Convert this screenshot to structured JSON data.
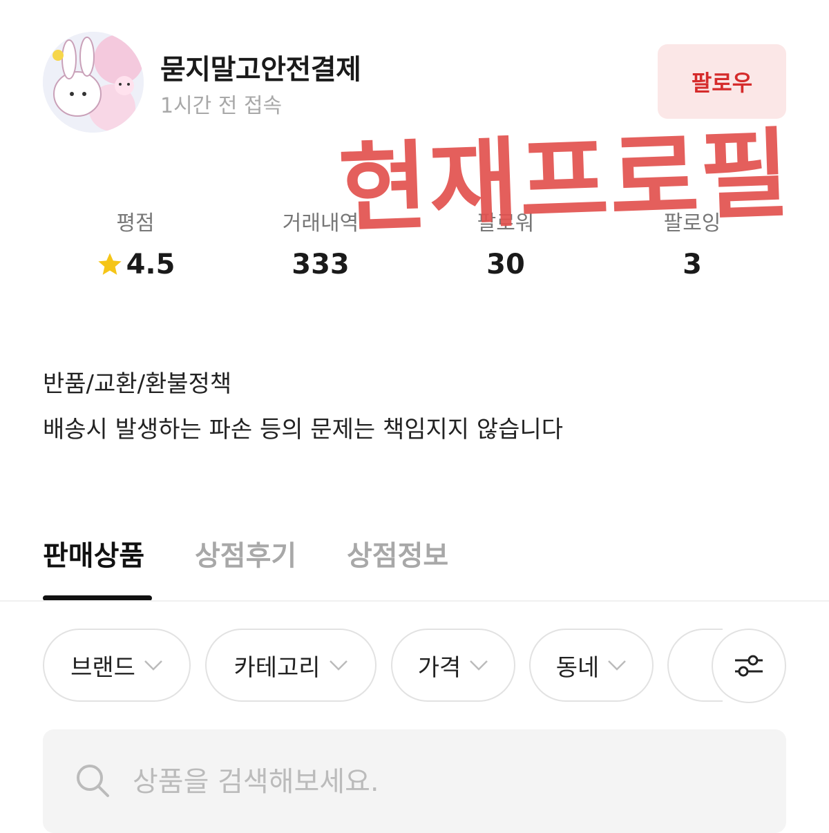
{
  "shop": {
    "name": "묻지말고안전결제",
    "last_seen": "1시간 전 접속",
    "follow_label": "팔로우"
  },
  "stats": [
    {
      "label": "평점",
      "value": "4.5",
      "icon": "star-icon"
    },
    {
      "label": "거래내역",
      "value": "333"
    },
    {
      "label": "팔로워",
      "value": "30"
    },
    {
      "label": "팔로잉",
      "value": "3"
    }
  ],
  "policy": {
    "title": "반품/교환/환불정책",
    "text": "배송시 발생하는 파손 등의 문제는 책임지지 않습니다"
  },
  "tabs": [
    {
      "label": "판매상품",
      "active": true
    },
    {
      "label": "상점후기",
      "active": false
    },
    {
      "label": "상점정보",
      "active": false
    }
  ],
  "filters": [
    "브랜드",
    "카테고리",
    "가격",
    "동네"
  ],
  "search": {
    "placeholder": "상품을 검색해보세요."
  },
  "annotation": {
    "text": "현재프로필",
    "color": "#e2524f"
  },
  "colors": {
    "accent": "#d52b2b",
    "follow_bg": "#fbe7e7",
    "star": "#f5c518"
  }
}
